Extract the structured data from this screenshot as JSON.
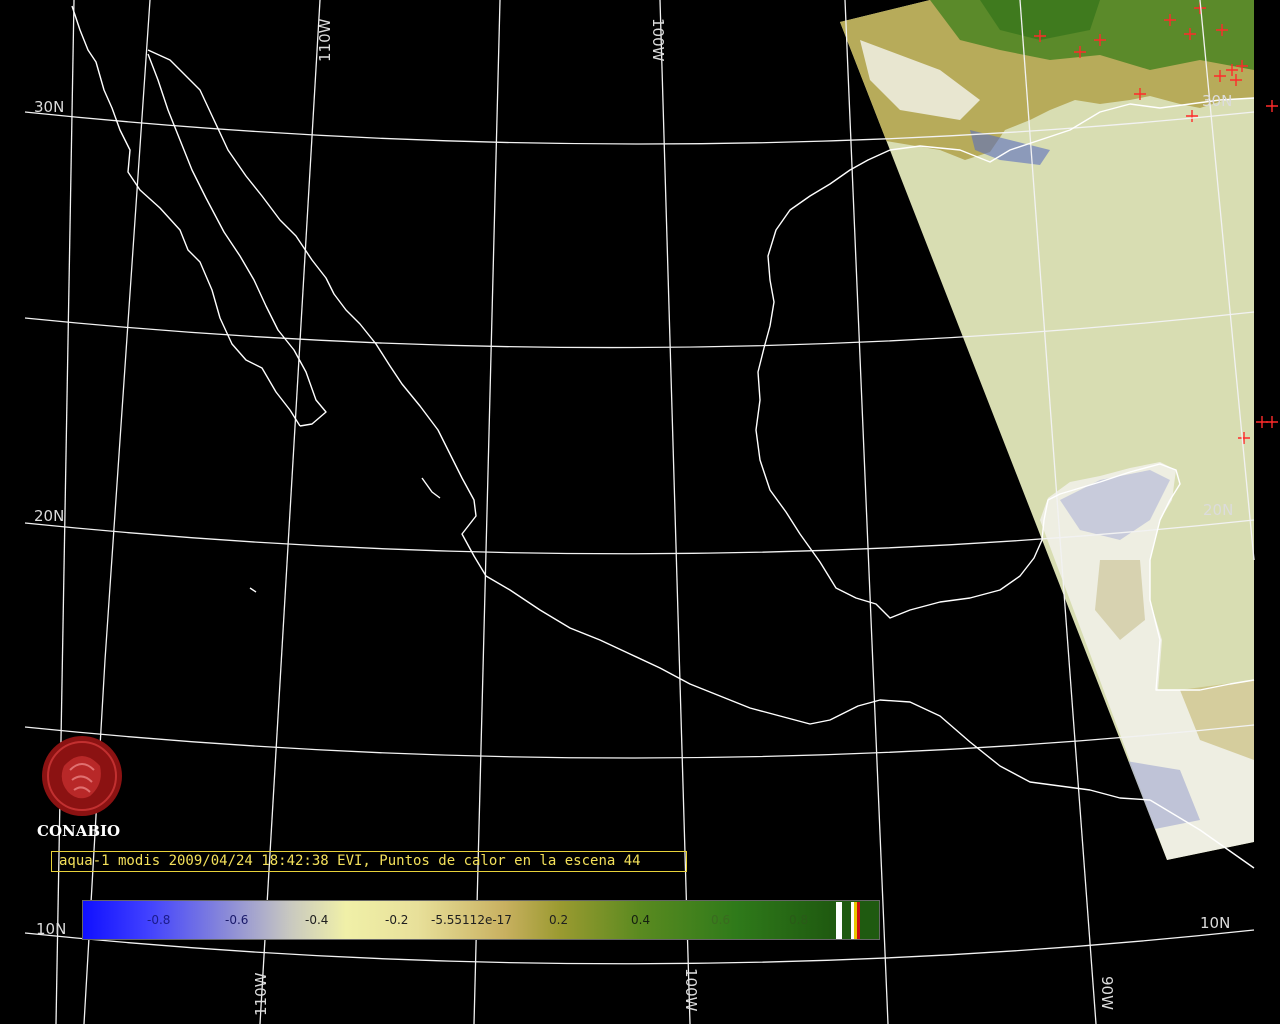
{
  "map": {
    "lat_labels": [
      "30N",
      "20N",
      "10N",
      "30N",
      "20N",
      "10N"
    ],
    "lon_labels": [
      "110W",
      "100W",
      "110W",
      "100W",
      "90W"
    ],
    "colors": {
      "background": "#000000",
      "grid": "#f2f2f2",
      "coastline": "#ffffff",
      "swath_ocean": "#d8ddb2",
      "fire_marker": "#ff2a2a"
    }
  },
  "logo": {
    "icon": "conabio-logo-icon",
    "text": "CONABIO"
  },
  "caption": {
    "text": "aqua-1 modis 2009/04/24 18:42:38 EVI, Puntos de calor en la escena 44"
  },
  "colorbar": {
    "ticks": [
      "-0.8",
      "-0.6",
      "-0.4",
      "-0.2",
      "-5.55112e-17",
      "0.2",
      "0.4",
      "0.6",
      "0.8"
    ]
  }
}
